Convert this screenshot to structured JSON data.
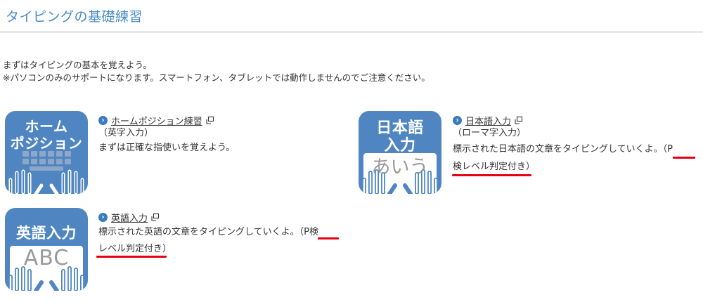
{
  "page": {
    "title": "タイピングの基礎練習",
    "intro_1": "まずはタイピングの基本を覚えよう。",
    "intro_2": "※パソコンのみのサポートになります。スマートフォン、タブレットでは動作しませんのでご注意ください。"
  },
  "items": [
    {
      "icon_text": [
        "ホーム",
        "ポジション"
      ],
      "link": "ホームポジション練習",
      "sub": "（英字入力）",
      "desc": "まずは正確な指使いを覚えよう。"
    },
    {
      "icon_text": [
        "日本語",
        "入力"
      ],
      "icon_sub": "あいう",
      "link": "日本語入力",
      "sub": "（ローマ字入力）",
      "desc": "標示された日本語の文章をタイピングしていくよ。",
      "desc_mark_1": "（P",
      "desc_mark_2": "検レベル判定付き）"
    },
    {
      "icon_text": [
        "英語入力"
      ],
      "icon_sub": "ABC",
      "link": "英語入力",
      "desc": "標示された英語の文章をタイピングしていくよ。",
      "desc_mark_1": "（P検",
      "desc_mark_2": "レベル判定付き）"
    }
  ],
  "colors": {
    "title": "#4a8bc7",
    "icon_bg": "#4f86c2",
    "chevron": "#3b7bbf",
    "underline_red": "#e60012"
  }
}
